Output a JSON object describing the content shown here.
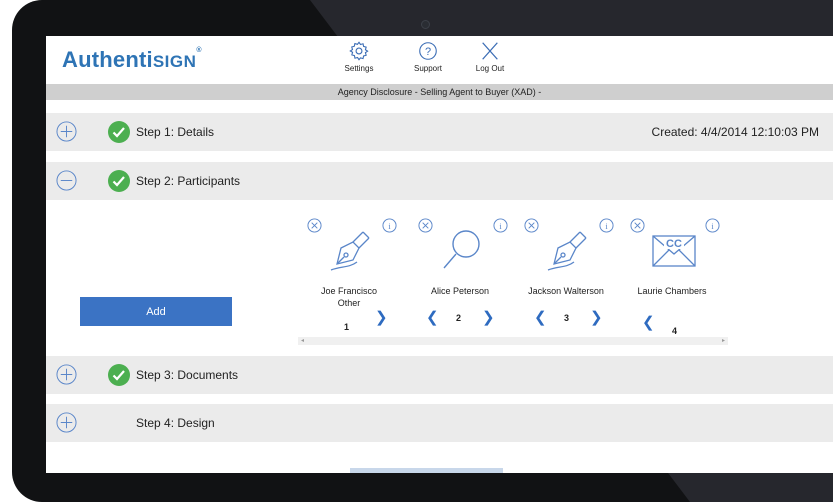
{
  "header": {
    "logo_main": "Authenti",
    "logo_sign": "SIGN",
    "logo_reg": "®",
    "settings_label": "Settings",
    "support_label": "Support",
    "logout_label": "Log Out"
  },
  "document_title": "Agency Disclosure - Selling Agent to Buyer (XAD) -",
  "steps": [
    {
      "label": "Step 1: Details",
      "complete": true,
      "expanded": false
    },
    {
      "label": "Step 2: Participants",
      "complete": true,
      "expanded": true
    },
    {
      "label": "Step 3: Documents",
      "complete": true,
      "expanded": false
    },
    {
      "label": "Step 4: Design",
      "complete": false,
      "expanded": false
    }
  ],
  "created_text": "Created: 4/4/2014 12:10:03 PM",
  "add_label": "Add",
  "participants": [
    {
      "name": "Joe Francisco",
      "role": "Other",
      "order": "1",
      "icon": "pen-nib-icon"
    },
    {
      "name": "Alice Peterson",
      "role": "",
      "order": "2",
      "icon": "magnifier-icon"
    },
    {
      "name": "Jackson Walterson",
      "role": "",
      "order": "3",
      "icon": "pen-nib-icon"
    },
    {
      "name": "Laurie Chambers",
      "role": "",
      "order": "4",
      "icon": "cc-envelope-icon"
    }
  ],
  "icons": {
    "cc_text": "CC",
    "info_glyph": "i",
    "support_glyph": "?"
  },
  "colors": {
    "brand_blue": "#2e74b5",
    "button_blue": "#3b73c4",
    "check_green": "#4caf50",
    "icon_blue": "#5a86c9",
    "device_bezel": "#111214"
  }
}
